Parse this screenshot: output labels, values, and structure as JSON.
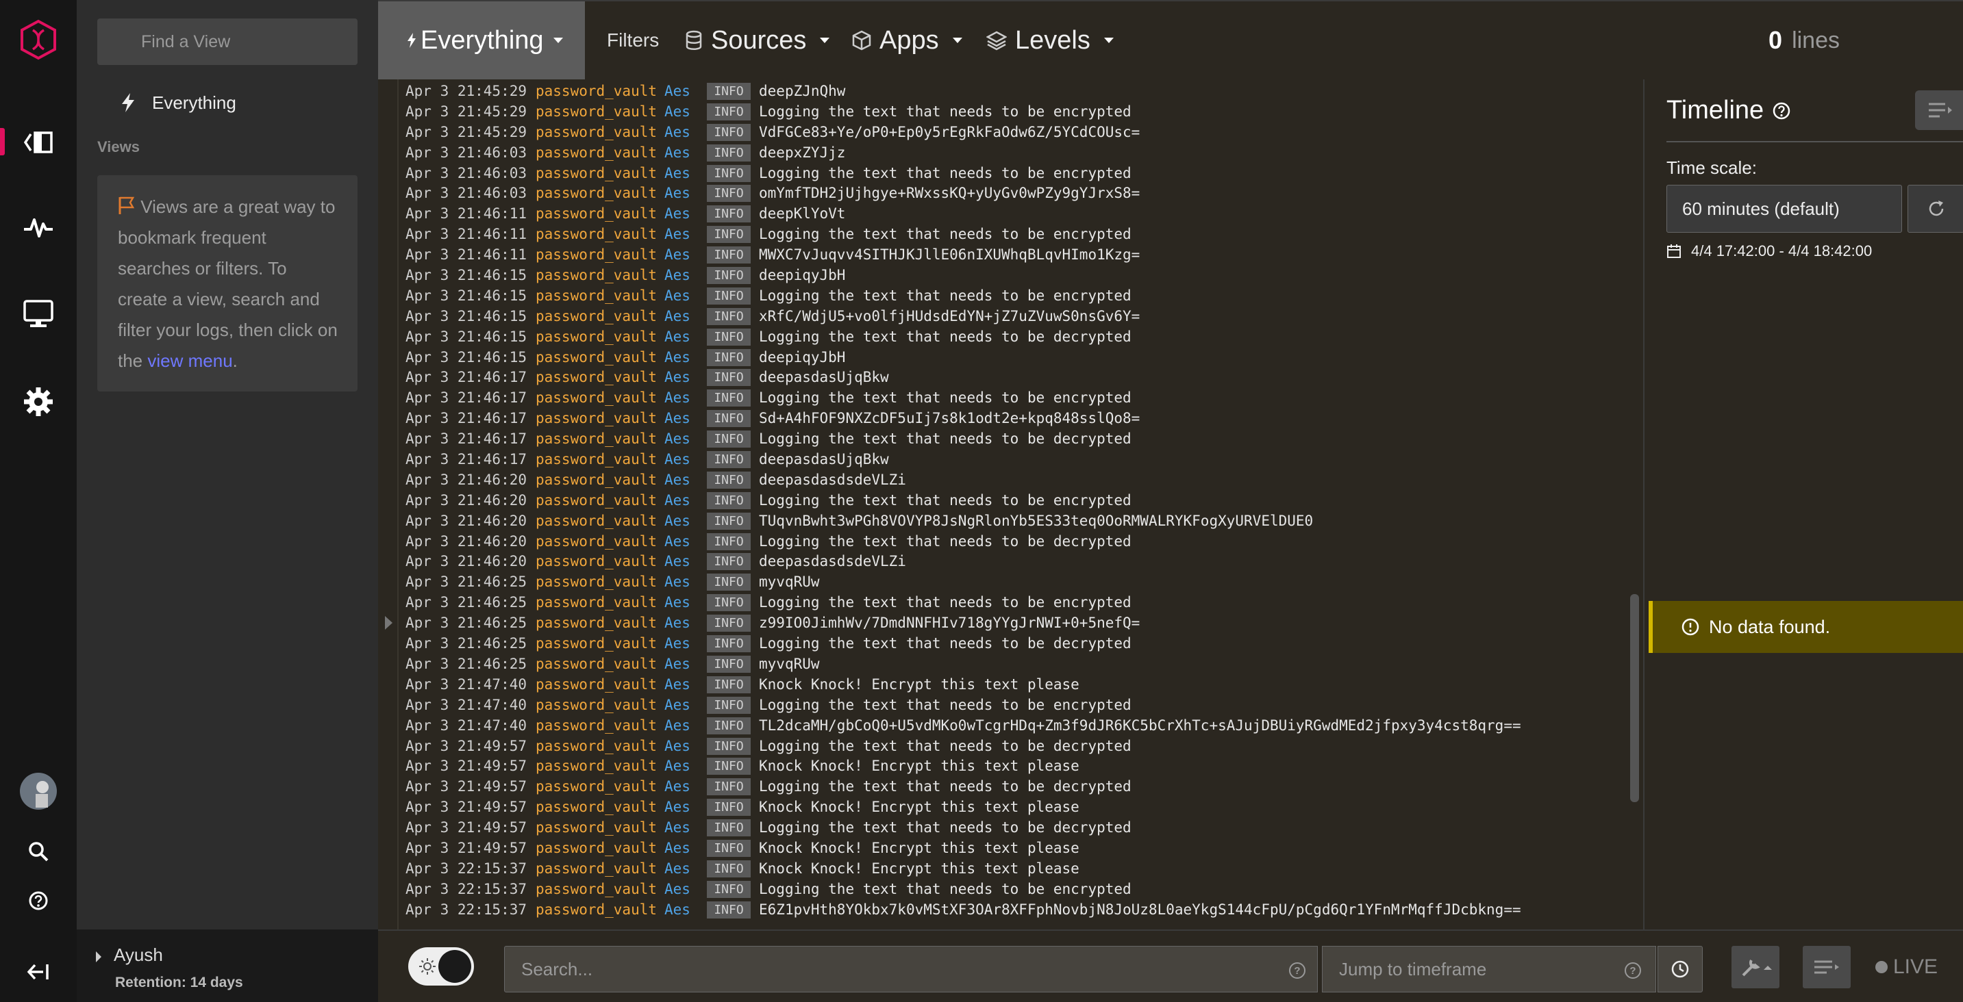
{
  "sidebar": {
    "find_view_placeholder": "Find a View",
    "everything_label": "Everything",
    "views_heading": "Views",
    "views_hint_prefix": "Views are a great way to bookmark frequent searches or filters. To create a view, search and filter your logs, then click on the",
    "views_hint_link": "view menu",
    "views_hint_suffix": ".",
    "user_name": "Ayush",
    "retention": "Retention: 14 days"
  },
  "topbar": {
    "active_view": "Everything",
    "filters": "Filters",
    "sources": "Sources",
    "apps": "Apps",
    "levels": "Levels",
    "lines_count": "0",
    "lines_label": "lines"
  },
  "logs": [
    {
      "ts": "Apr 3 21:45:29",
      "app": "password_vault",
      "src": "Aes",
      "level": "INFO",
      "msg": "deepZJnQhw"
    },
    {
      "ts": "Apr 3 21:45:29",
      "app": "password_vault",
      "src": "Aes",
      "level": "INFO",
      "msg": "Logging the text that needs to be encrypted"
    },
    {
      "ts": "Apr 3 21:45:29",
      "app": "password_vault",
      "src": "Aes",
      "level": "INFO",
      "msg": "VdFGCe83+Ye/oP0+Ep0y5rEgRkFaOdw6Z/5YCdCOUsc="
    },
    {
      "ts": "Apr 3 21:46:03",
      "app": "password_vault",
      "src": "Aes",
      "level": "INFO",
      "msg": "deepxZYJjz"
    },
    {
      "ts": "Apr 3 21:46:03",
      "app": "password_vault",
      "src": "Aes",
      "level": "INFO",
      "msg": "Logging the text that needs to be encrypted"
    },
    {
      "ts": "Apr 3 21:46:03",
      "app": "password_vault",
      "src": "Aes",
      "level": "INFO",
      "msg": "omYmfTDH2jUjhgye+RWxssKQ+yUyGv0wPZy9gYJrxS8="
    },
    {
      "ts": "Apr 3 21:46:11",
      "app": "password_vault",
      "src": "Aes",
      "level": "INFO",
      "msg": "deepKlYoVt"
    },
    {
      "ts": "Apr 3 21:46:11",
      "app": "password_vault",
      "src": "Aes",
      "level": "INFO",
      "msg": "Logging the text that needs to be encrypted"
    },
    {
      "ts": "Apr 3 21:46:11",
      "app": "password_vault",
      "src": "Aes",
      "level": "INFO",
      "msg": "MWXC7vJuqvv4SITHJKJllE06nIXUWhqBLqvHImo1Kzg="
    },
    {
      "ts": "Apr 3 21:46:15",
      "app": "password_vault",
      "src": "Aes",
      "level": "INFO",
      "msg": "deepiqyJbH"
    },
    {
      "ts": "Apr 3 21:46:15",
      "app": "password_vault",
      "src": "Aes",
      "level": "INFO",
      "msg": "Logging the text that needs to be encrypted"
    },
    {
      "ts": "Apr 3 21:46:15",
      "app": "password_vault",
      "src": "Aes",
      "level": "INFO",
      "msg": "xRfC/WdjU5+vo0lfjHUdsdEdYN+jZ7uZVuwS0nsGv6Y="
    },
    {
      "ts": "Apr 3 21:46:15",
      "app": "password_vault",
      "src": "Aes",
      "level": "INFO",
      "msg": "Logging the text that needs to be decrypted"
    },
    {
      "ts": "Apr 3 21:46:15",
      "app": "password_vault",
      "src": "Aes",
      "level": "INFO",
      "msg": "deepiqyJbH"
    },
    {
      "ts": "Apr 3 21:46:17",
      "app": "password_vault",
      "src": "Aes",
      "level": "INFO",
      "msg": "deepasdasUjqBkw"
    },
    {
      "ts": "Apr 3 21:46:17",
      "app": "password_vault",
      "src": "Aes",
      "level": "INFO",
      "msg": "Logging the text that needs to be encrypted"
    },
    {
      "ts": "Apr 3 21:46:17",
      "app": "password_vault",
      "src": "Aes",
      "level": "INFO",
      "msg": "Sd+A4hFOF9NXZcDF5uIj7s8k1odt2e+kpq848sslQo8="
    },
    {
      "ts": "Apr 3 21:46:17",
      "app": "password_vault",
      "src": "Aes",
      "level": "INFO",
      "msg": "Logging the text that needs to be decrypted"
    },
    {
      "ts": "Apr 3 21:46:17",
      "app": "password_vault",
      "src": "Aes",
      "level": "INFO",
      "msg": "deepasdasUjqBkw"
    },
    {
      "ts": "Apr 3 21:46:20",
      "app": "password_vault",
      "src": "Aes",
      "level": "INFO",
      "msg": "deepasdasdsdeVLZi"
    },
    {
      "ts": "Apr 3 21:46:20",
      "app": "password_vault",
      "src": "Aes",
      "level": "INFO",
      "msg": "Logging the text that needs to be encrypted"
    },
    {
      "ts": "Apr 3 21:46:20",
      "app": "password_vault",
      "src": "Aes",
      "level": "INFO",
      "msg": "TUqvnBwht3wPGh8VOVYP8JsNgRlonYb5ES33teq0OoRMWALRYKFogXyURVElDUE0"
    },
    {
      "ts": "Apr 3 21:46:20",
      "app": "password_vault",
      "src": "Aes",
      "level": "INFO",
      "msg": "Logging the text that needs to be decrypted"
    },
    {
      "ts": "Apr 3 21:46:20",
      "app": "password_vault",
      "src": "Aes",
      "level": "INFO",
      "msg": "deepasdasdsdeVLZi"
    },
    {
      "ts": "Apr 3 21:46:25",
      "app": "password_vault",
      "src": "Aes",
      "level": "INFO",
      "msg": "myvqRUw"
    },
    {
      "ts": "Apr 3 21:46:25",
      "app": "password_vault",
      "src": "Aes",
      "level": "INFO",
      "msg": "Logging the text that needs to be encrypted"
    },
    {
      "ts": "Apr 3 21:46:25",
      "app": "password_vault",
      "src": "Aes",
      "level": "INFO",
      "msg": "z99IO0JimhWv/7DmdNNFHIv718gYYgJrNWI+0+5nefQ="
    },
    {
      "ts": "Apr 3 21:46:25",
      "app": "password_vault",
      "src": "Aes",
      "level": "INFO",
      "msg": "Logging the text that needs to be decrypted"
    },
    {
      "ts": "Apr 3 21:46:25",
      "app": "password_vault",
      "src": "Aes",
      "level": "INFO",
      "msg": "myvqRUw"
    },
    {
      "ts": "Apr 3 21:47:40",
      "app": "password_vault",
      "src": "Aes",
      "level": "INFO",
      "msg": "Knock Knock! Encrypt this text please"
    },
    {
      "ts": "Apr 3 21:47:40",
      "app": "password_vault",
      "src": "Aes",
      "level": "INFO",
      "msg": "Logging the text that needs to be encrypted"
    },
    {
      "ts": "Apr 3 21:47:40",
      "app": "password_vault",
      "src": "Aes",
      "level": "INFO",
      "msg": "TL2dcaMH/gbCoQ0+U5vdMKo0wTcgrHDq+Zm3f9dJR6KC5bCrXhTc+sAJujDBUiyRGwdMEd2jfpxy3y4cst8qrg=="
    },
    {
      "ts": "Apr 3 21:49:57",
      "app": "password_vault",
      "src": "Aes",
      "level": "INFO",
      "msg": "Logging the text that needs to be decrypted"
    },
    {
      "ts": "Apr 3 21:49:57",
      "app": "password_vault",
      "src": "Aes",
      "level": "INFO",
      "msg": "Knock Knock! Encrypt this text please"
    },
    {
      "ts": "Apr 3 21:49:57",
      "app": "password_vault",
      "src": "Aes",
      "level": "INFO",
      "msg": "Logging the text that needs to be decrypted"
    },
    {
      "ts": "Apr 3 21:49:57",
      "app": "password_vault",
      "src": "Aes",
      "level": "INFO",
      "msg": "Knock Knock! Encrypt this text please"
    },
    {
      "ts": "Apr 3 21:49:57",
      "app": "password_vault",
      "src": "Aes",
      "level": "INFO",
      "msg": "Logging the text that needs to be decrypted"
    },
    {
      "ts": "Apr 3 21:49:57",
      "app": "password_vault",
      "src": "Aes",
      "level": "INFO",
      "msg": "Knock Knock! Encrypt this text please"
    },
    {
      "ts": "Apr 3 22:15:37",
      "app": "password_vault",
      "src": "Aes",
      "level": "INFO",
      "msg": "Knock Knock! Encrypt this text please"
    },
    {
      "ts": "Apr 3 22:15:37",
      "app": "password_vault",
      "src": "Aes",
      "level": "INFO",
      "msg": "Logging the text that needs to be encrypted"
    },
    {
      "ts": "Apr 3 22:15:37",
      "app": "password_vault",
      "src": "Aes",
      "level": "INFO",
      "msg": "E6Z1pvHth8YOkbx7k0vMStXF3OAr8XFFphNovbjN8JoUz8L0aeYkgS144cFpU/pCgd6Qr1YFnMrMqffJDcbkng=="
    }
  ],
  "timeline": {
    "title": "Timeline",
    "time_scale_label": "Time scale:",
    "time_scale_value": "60 minutes (default)",
    "range": "4/4 17:42:00 - 4/4 18:42:00",
    "no_data": "No data found."
  },
  "bottombar": {
    "search_placeholder": "Search...",
    "jump_placeholder": "Jump to timeframe",
    "live": "LIVE"
  },
  "colors": {
    "brand_pink": "#e0115f",
    "app_name": "#f0a63c",
    "source_name": "#4fa3e6",
    "link": "#6f78ff",
    "warning_bg": "#5b4f00"
  }
}
